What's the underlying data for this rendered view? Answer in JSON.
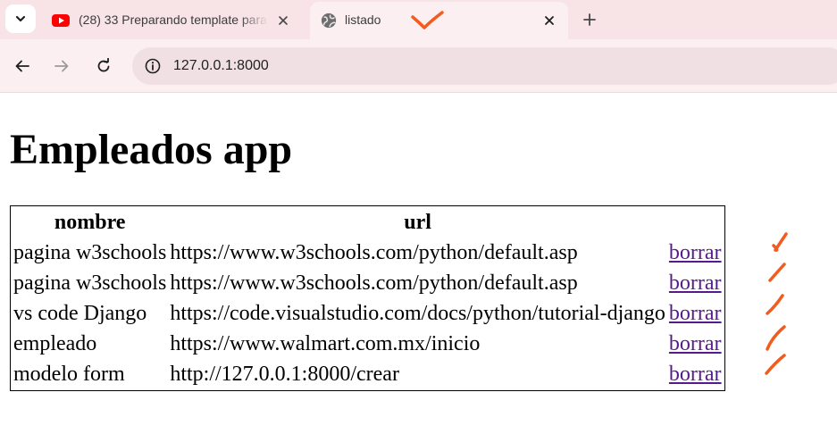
{
  "browser": {
    "tabs": [
      {
        "title": "(28) 33 Preparando template para",
        "favicon": "youtube-icon",
        "active": false
      },
      {
        "title": "listado",
        "favicon": "globe-icon",
        "active": true
      }
    ],
    "address_bar": {
      "url": "127.0.0.1:8000"
    },
    "accent_color": "#f8e3e6"
  },
  "page": {
    "title": "Empleados app",
    "table": {
      "headers": [
        "nombre",
        "url",
        ""
      ],
      "rows": [
        {
          "nombre": "pagina w3schools",
          "url": "https://www.w3schools.com/python/default.asp",
          "action": "borrar"
        },
        {
          "nombre": "pagina w3schools",
          "url": "https://www.w3schools.com/python/default.asp",
          "action": "borrar"
        },
        {
          "nombre": "vs code Django",
          "url": "https://code.visualstudio.com/docs/python/tutorial-django",
          "action": "borrar"
        },
        {
          "nombre": "empleado",
          "url": "https://www.walmart.com.mx/inicio",
          "action": "borrar"
        },
        {
          "nombre": "modelo form",
          "url": "http://127.0.0.1:8000/crear",
          "action": "borrar"
        }
      ]
    },
    "link_color": "#551a8b"
  },
  "annotations": {
    "color": "#f25c1f"
  }
}
